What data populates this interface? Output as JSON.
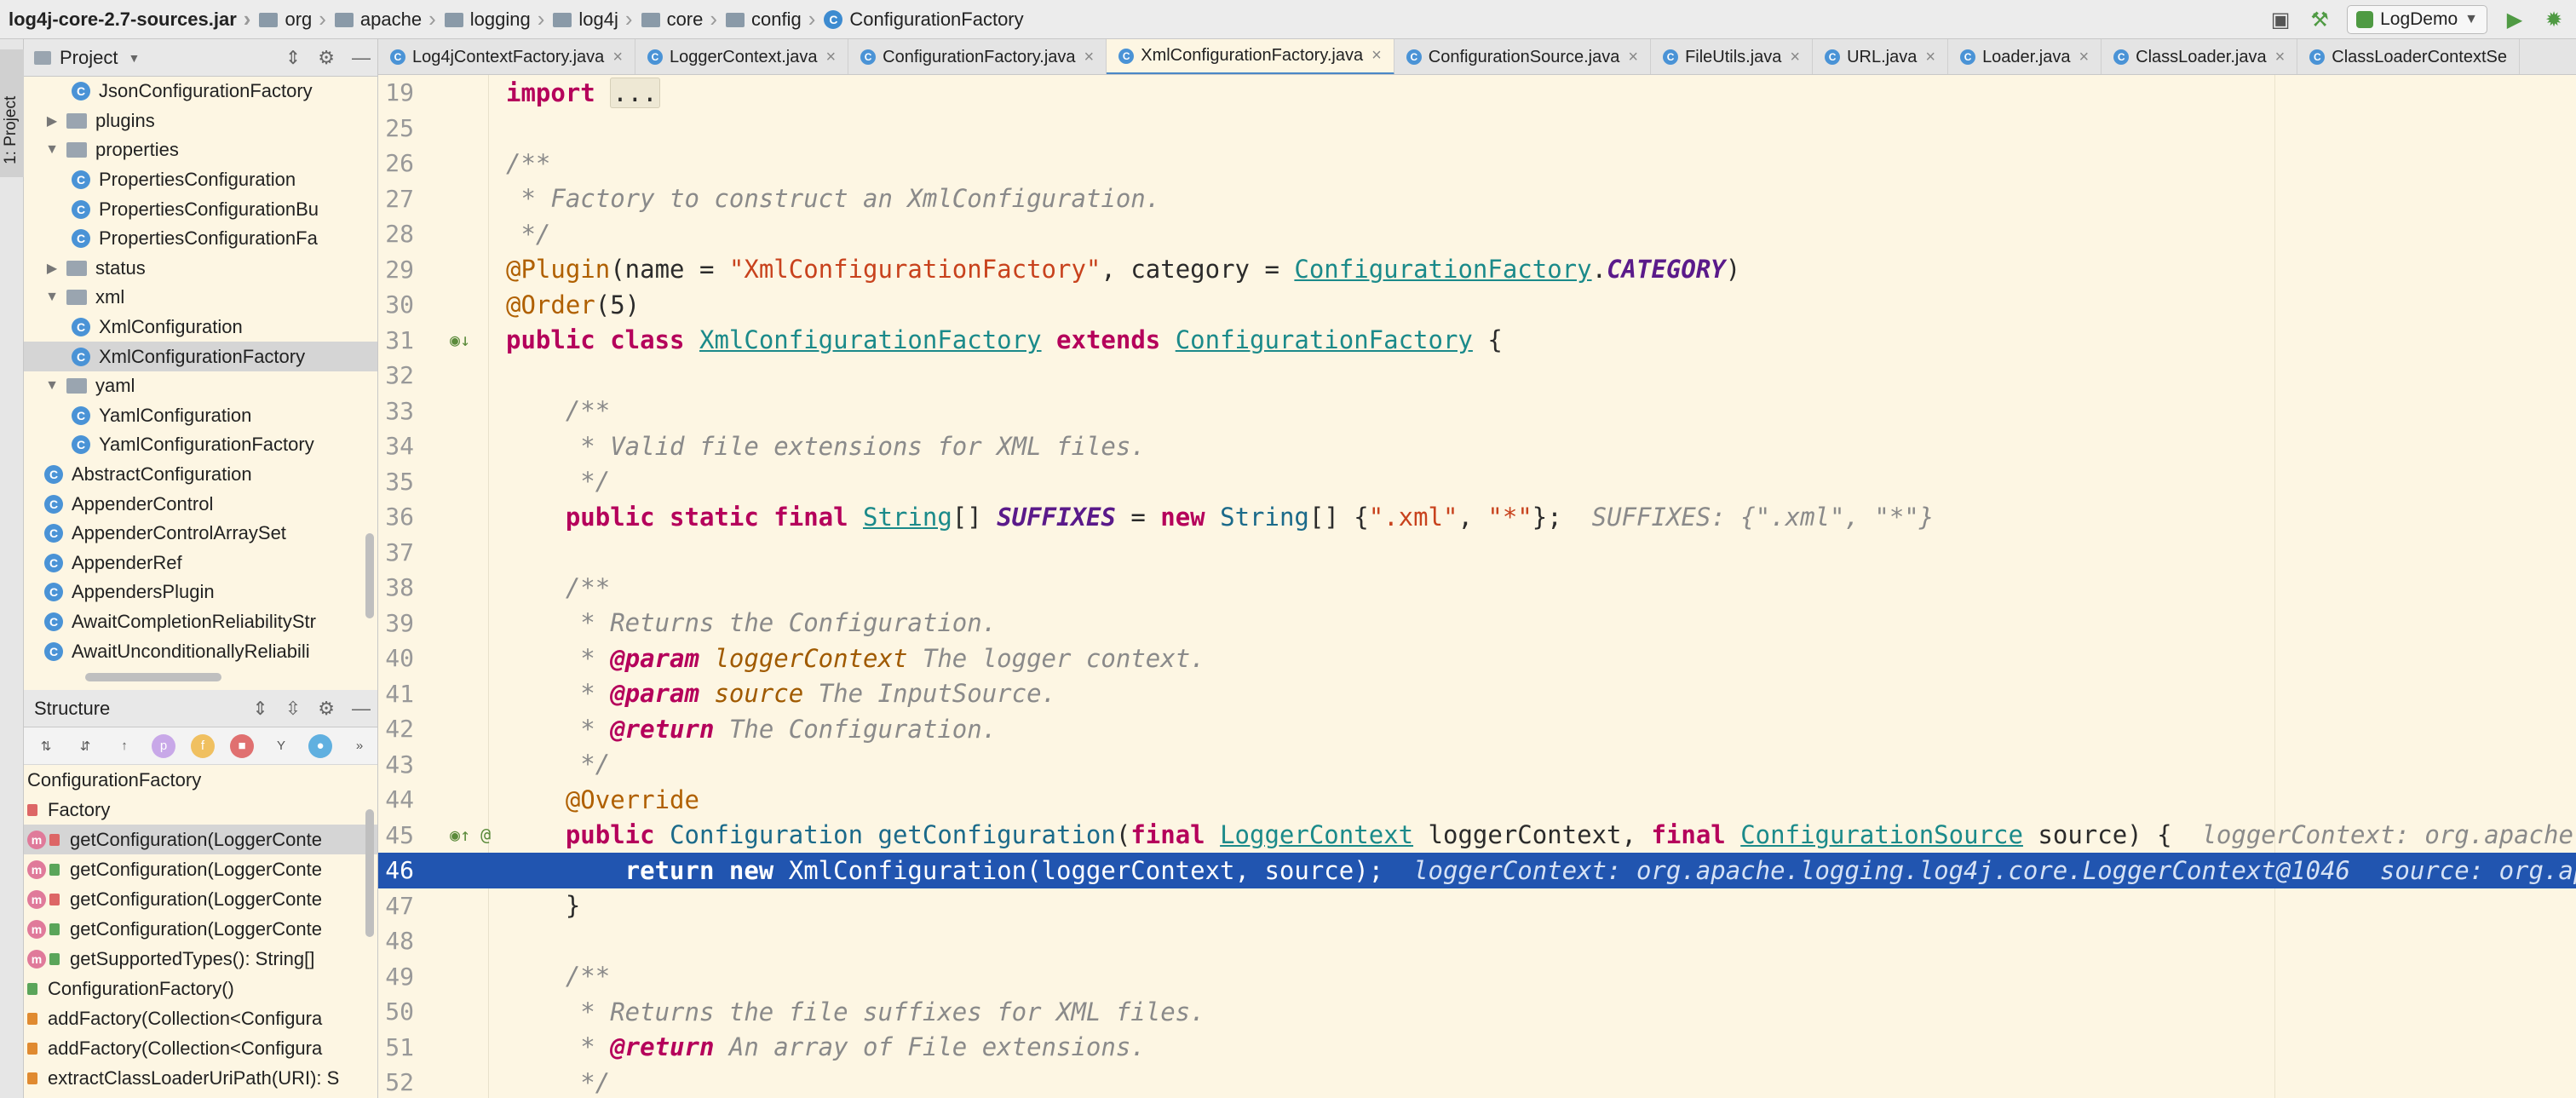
{
  "breadcrumbs": [
    {
      "label": "log4j-core-2.7-sources.jar",
      "icon": "jar-icon"
    },
    {
      "label": "org",
      "icon": "folder-icon"
    },
    {
      "label": "apache",
      "icon": "folder-icon"
    },
    {
      "label": "logging",
      "icon": "folder-icon"
    },
    {
      "label": "log4j",
      "icon": "folder-icon"
    },
    {
      "label": "core",
      "icon": "folder-icon"
    },
    {
      "label": "config",
      "icon": "folder-icon"
    },
    {
      "label": "ConfigurationFactory",
      "icon": "class-icon"
    }
  ],
  "toolbar": {
    "run_config": "LogDemo"
  },
  "left_strip": {
    "tab": "1: Project"
  },
  "project_panel": {
    "title": "Project",
    "rows": [
      {
        "indent": 2,
        "type": "class",
        "label": "JsonConfigurationFactory"
      },
      {
        "indent": 1,
        "type": "pkg",
        "arrow": "▶",
        "label": "plugins"
      },
      {
        "indent": 1,
        "type": "pkg",
        "arrow": "▼",
        "label": "properties"
      },
      {
        "indent": 2,
        "type": "class",
        "label": "PropertiesConfiguration"
      },
      {
        "indent": 2,
        "type": "class",
        "label": "PropertiesConfigurationBu"
      },
      {
        "indent": 2,
        "type": "class",
        "label": "PropertiesConfigurationFa"
      },
      {
        "indent": 1,
        "type": "pkg",
        "arrow": "▶",
        "label": "status"
      },
      {
        "indent": 1,
        "type": "pkg",
        "arrow": "▼",
        "label": "xml"
      },
      {
        "indent": 2,
        "type": "class",
        "label": "XmlConfiguration"
      },
      {
        "indent": 2,
        "type": "class",
        "label": "XmlConfigurationFactory",
        "selected": true
      },
      {
        "indent": 1,
        "type": "pkg",
        "arrow": "▼",
        "label": "yaml"
      },
      {
        "indent": 2,
        "type": "class",
        "label": "YamlConfiguration"
      },
      {
        "indent": 2,
        "type": "class",
        "label": "YamlConfigurationFactory"
      },
      {
        "indent": 1,
        "type": "class",
        "label": "AbstractConfiguration"
      },
      {
        "indent": 1,
        "type": "class",
        "label": "AppenderControl"
      },
      {
        "indent": 1,
        "type": "class",
        "label": "AppenderControlArraySet"
      },
      {
        "indent": 1,
        "type": "class",
        "label": "AppenderRef"
      },
      {
        "indent": 1,
        "type": "class",
        "label": "AppendersPlugin"
      },
      {
        "indent": 1,
        "type": "class",
        "label": "AwaitCompletionReliabilityStr"
      },
      {
        "indent": 1,
        "type": "class",
        "label": "AwaitUnconditionallyReliabili"
      }
    ]
  },
  "structure_panel": {
    "title": "Structure",
    "toolbar_icons": [
      "sort-alpha-icon",
      "sort-visibility-icon",
      "show-inherited-icon",
      "show-properties-icon",
      "show-fields-icon",
      "show-non-public-icon",
      "show-lambdas-icon",
      "show-anonymous-icon",
      "more-icon"
    ],
    "rows": [
      {
        "kind": "root",
        "label": "ConfigurationFactory"
      },
      {
        "kind": "inner",
        "lock": "red",
        "label": "Factory"
      },
      {
        "kind": "method",
        "lock": "red",
        "label": "getConfiguration(LoggerConte",
        "selected": true
      },
      {
        "kind": "method",
        "lock": "green",
        "label": "getConfiguration(LoggerConte"
      },
      {
        "kind": "method",
        "lock": "red",
        "label": "getConfiguration(LoggerConte"
      },
      {
        "kind": "method",
        "lock": "green",
        "label": "getConfiguration(LoggerConte"
      },
      {
        "kind": "method",
        "lock": "green",
        "label": "getSupportedTypes(): String[]"
      },
      {
        "kind": "ctor",
        "lock": "green",
        "label": "ConfigurationFactory()"
      },
      {
        "kind": "static",
        "lock": "orange",
        "label": "addFactory(Collection<Configura"
      },
      {
        "kind": "static",
        "lock": "orange",
        "label": "addFactory(Collection<Configura"
      },
      {
        "kind": "static",
        "lock": "orange",
        "label": "extractClassLoaderUriPath(URI): S"
      }
    ]
  },
  "editor_tabs": [
    {
      "label": "Log4jContextFactory.java"
    },
    {
      "label": "LoggerContext.java"
    },
    {
      "label": "ConfigurationFactory.java"
    },
    {
      "label": "XmlConfigurationFactory.java",
      "active": true
    },
    {
      "label": "ConfigurationSource.java"
    },
    {
      "label": "FileUtils.java"
    },
    {
      "label": "URL.java"
    },
    {
      "label": "Loader.java"
    },
    {
      "label": "ClassLoader.java"
    },
    {
      "label": "ClassLoaderContextSe"
    }
  ],
  "editor": {
    "lines": [
      {
        "n": "19",
        "segs": [
          {
            "t": "import ",
            "c": "kw"
          },
          {
            "t": "...",
            "c": "fold"
          }
        ]
      },
      {
        "n": "25",
        "segs": []
      },
      {
        "n": "26",
        "segs": [
          {
            "t": "/**",
            "c": "cm"
          }
        ]
      },
      {
        "n": "27",
        "segs": [
          {
            "t": " * Factory to construct an XmlConfiguration.",
            "c": "cm"
          }
        ]
      },
      {
        "n": "28",
        "segs": [
          {
            "t": " */",
            "c": "cm"
          }
        ]
      },
      {
        "n": "29",
        "segs": [
          {
            "t": "@Plugin",
            "c": "ann"
          },
          {
            "t": "(name = "
          },
          {
            "t": "\"XmlConfigurationFactory\"",
            "c": "str"
          },
          {
            "t": ", category = "
          },
          {
            "t": "ConfigurationFactory",
            "c": "link"
          },
          {
            "t": "."
          },
          {
            "t": "CATEGORY",
            "c": "const"
          },
          {
            "t": ")"
          }
        ]
      },
      {
        "n": "30",
        "segs": [
          {
            "t": "@Order",
            "c": "ann"
          },
          {
            "t": "(5)"
          }
        ]
      },
      {
        "n": "31",
        "gutter": "◉↓",
        "segs": [
          {
            "t": "public class ",
            "c": "kw"
          },
          {
            "t": "XmlConfigurationFactory",
            "c": "link"
          },
          {
            "t": " extends ",
            "c": "kw"
          },
          {
            "t": "ConfigurationFactory",
            "c": "link"
          },
          {
            "t": " {"
          }
        ]
      },
      {
        "n": "32",
        "segs": []
      },
      {
        "n": "33",
        "segs": [
          {
            "t": "    /**",
            "c": "cm"
          }
        ]
      },
      {
        "n": "34",
        "segs": [
          {
            "t": "     * Valid file extensions for XML files.",
            "c": "cm"
          }
        ]
      },
      {
        "n": "35",
        "segs": [
          {
            "t": "     */",
            "c": "cm"
          }
        ]
      },
      {
        "n": "36",
        "segs": [
          {
            "t": "    public static final ",
            "c": "kw"
          },
          {
            "t": "String",
            "c": "link"
          },
          {
            "t": "[] "
          },
          {
            "t": "SUFFIXES",
            "c": "const"
          },
          {
            "t": " = "
          },
          {
            "t": "new ",
            "c": "kw"
          },
          {
            "t": "String",
            "c": "type"
          },
          {
            "t": "[] {"
          },
          {
            "t": "\".xml\"",
            "c": "str"
          },
          {
            "t": ", "
          },
          {
            "t": "\"*\"",
            "c": "str"
          },
          {
            "t": "};  "
          },
          {
            "t": "SUFFIXES: {\".xml\", \"*\"}",
            "c": "hint"
          }
        ]
      },
      {
        "n": "37",
        "segs": []
      },
      {
        "n": "38",
        "segs": [
          {
            "t": "    /**",
            "c": "cm"
          }
        ]
      },
      {
        "n": "39",
        "segs": [
          {
            "t": "     * Returns the Configuration.",
            "c": "cm"
          }
        ]
      },
      {
        "n": "40",
        "segs": [
          {
            "t": "     * ",
            "c": "cm"
          },
          {
            "t": "@param",
            "c": "cm-tag"
          },
          {
            "t": " loggerContext",
            "c": "cm-param"
          },
          {
            "t": " The logger context.",
            "c": "cm"
          }
        ]
      },
      {
        "n": "41",
        "segs": [
          {
            "t": "     * ",
            "c": "cm"
          },
          {
            "t": "@param",
            "c": "cm-tag"
          },
          {
            "t": " source",
            "c": "cm-param"
          },
          {
            "t": " The InputSource.",
            "c": "cm"
          }
        ]
      },
      {
        "n": "42",
        "segs": [
          {
            "t": "     * ",
            "c": "cm"
          },
          {
            "t": "@return",
            "c": "cm-tag"
          },
          {
            "t": " The Configuration.",
            "c": "cm"
          }
        ]
      },
      {
        "n": "43",
        "segs": [
          {
            "t": "     */",
            "c": "cm"
          }
        ]
      },
      {
        "n": "44",
        "segs": [
          {
            "t": "    @Override",
            "c": "ann"
          }
        ]
      },
      {
        "n": "45",
        "gutter": "◉↑ @",
        "segs": [
          {
            "t": "    public ",
            "c": "kw"
          },
          {
            "t": "Configuration ",
            "c": "type"
          },
          {
            "t": "getConfiguration",
            "c": "type"
          },
          {
            "t": "("
          },
          {
            "t": "final ",
            "c": "kw"
          },
          {
            "t": "LoggerContext",
            "c": "link"
          },
          {
            "t": " loggerContext, "
          },
          {
            "t": "final ",
            "c": "kw"
          },
          {
            "t": "ConfigurationSource",
            "c": "link"
          },
          {
            "t": " source) {  "
          },
          {
            "t": "loggerContext: org.apache.",
            "c": "hint"
          }
        ]
      },
      {
        "n": "46",
        "exec": true,
        "segs": [
          {
            "t": "        return new ",
            "c": "kw"
          },
          {
            "t": "XmlConfiguration(loggerContext, source);  "
          },
          {
            "t": "loggerContext: org.apache.logging.log4j.core.LoggerContext@1046  source: org.apa",
            "c": "hint"
          }
        ]
      },
      {
        "n": "47",
        "segs": [
          {
            "t": "    }"
          }
        ]
      },
      {
        "n": "48",
        "segs": []
      },
      {
        "n": "49",
        "segs": [
          {
            "t": "    /**",
            "c": "cm"
          }
        ]
      },
      {
        "n": "50",
        "segs": [
          {
            "t": "     * Returns the file suffixes for XML files.",
            "c": "cm"
          }
        ]
      },
      {
        "n": "51",
        "segs": [
          {
            "t": "     * ",
            "c": "cm"
          },
          {
            "t": "@return",
            "c": "cm-tag"
          },
          {
            "t": " An array of File extensions.",
            "c": "cm"
          }
        ]
      },
      {
        "n": "52",
        "segs": [
          {
            "t": "     */",
            "c": "cm"
          }
        ]
      }
    ]
  }
}
